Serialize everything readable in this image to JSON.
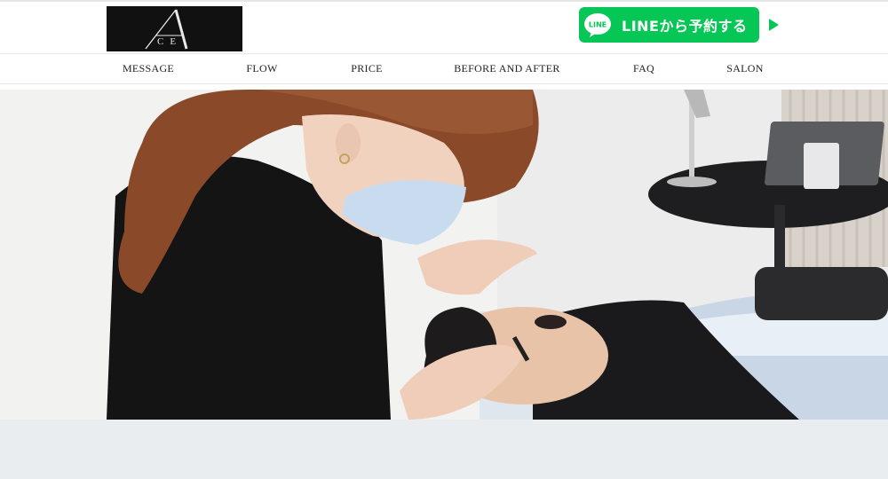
{
  "header": {
    "logo_alt": "ACE",
    "logo_letter": "A",
    "logo_sub": "CE",
    "line_button_label": "LINEから予約する",
    "line_icon_text": "LINE"
  },
  "nav": {
    "items": [
      {
        "label": "MESSAGE",
        "name": "nav-item-message"
      },
      {
        "label": "FLOW",
        "name": "nav-item-flow"
      },
      {
        "label": "PRICE",
        "name": "nav-item-price"
      },
      {
        "label": "BEFORE AND AFTER",
        "name": "nav-item-before-and-after"
      },
      {
        "label": "FAQ",
        "name": "nav-item-faq"
      },
      {
        "label": "SALON",
        "name": "nav-item-salon"
      }
    ]
  },
  "colors": {
    "line_green": "#06c755",
    "logo_bg": "#111111",
    "footer_band": "#e9edf0"
  },
  "hero": {
    "image_subject": "photo-of-beautician-trimming-eyebrows"
  }
}
